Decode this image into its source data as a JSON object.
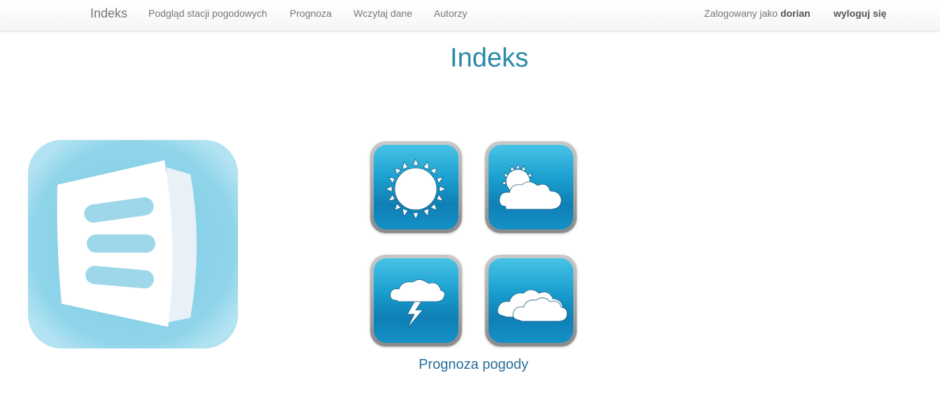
{
  "navbar": {
    "brand": "Indeks",
    "links": [
      "Podgląd stacji pogodowych",
      "Prognoza",
      "Wczytaj dane",
      "Autorzy"
    ],
    "logged_in_prefix": "Zalogowany jako ",
    "username": "dorian",
    "logout": "wyloguj się"
  },
  "page": {
    "title": "Indeks",
    "forecast_link": "Prognoza pogody"
  },
  "colors": {
    "accent": "#2a8aa8",
    "link": "#2a6e9a",
    "tile_blue": "#1a9fcf",
    "app_icon_bg": "#8fd4ea"
  },
  "icons": {
    "app": "document-list-icon",
    "weather": [
      "sun-icon",
      "partly-cloudy-icon",
      "thunderstorm-icon",
      "cloudy-icon"
    ]
  }
}
